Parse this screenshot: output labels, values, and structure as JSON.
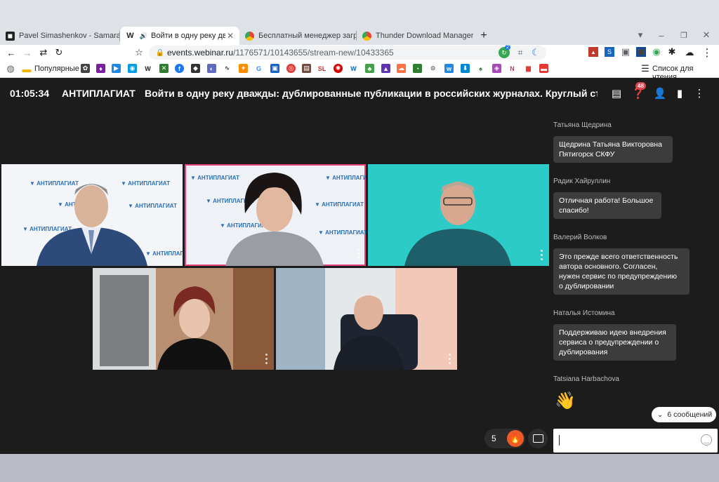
{
  "browser": {
    "tabs": [
      {
        "title": "Pavel Simashenkov - Samara, Ros",
        "favicon": "ms"
      },
      {
        "title": "Войти в одну реку дважды",
        "favicon": "W",
        "active": true
      },
      {
        "title": "Бесплатный менеджер загрузок",
        "favicon": "chrome"
      },
      {
        "title": "Thunder Download Manager - И",
        "favicon": "chrome"
      }
    ],
    "new_tab": "+",
    "window_controls": [
      "▾",
      "–",
      "❐",
      "✕"
    ],
    "url_host": "events.webinar.ru",
    "url_path": "/1176571/10143655/stream-new/10433365",
    "bookmarks_folder": "Популярные",
    "reading_list": "Список для чтения",
    "ext_badge": "2"
  },
  "webinar": {
    "timer": "01:05:34",
    "brand": "АНТИПЛАГИАТ",
    "title": "Войти в одну реку дважды: дублированные публикации в российских журналах. Круглый стол",
    "questions_badge": "48",
    "videos": [
      {
        "name": "participant-1",
        "logo": "АНТИПЛАГИАТ"
      },
      {
        "name": "participant-2",
        "logo": "АНТИПЛАГИАТ",
        "active_speaker": true
      },
      {
        "name": "participant-3"
      },
      {
        "name": "participant-4"
      },
      {
        "name": "participant-5"
      }
    ],
    "reactions_count": "5",
    "colors": {
      "accent": "#e8407a",
      "bg": "#1c1c1c",
      "fire": "#f05a24"
    }
  },
  "chat": {
    "messages": [
      {
        "author": "Татьяна Щедрина",
        "lines": [
          "Щедрина Татьяна Викторовна",
          "Пятигорск СКФУ"
        ]
      },
      {
        "author": "Радик Хайруллин",
        "lines": [
          "Отличная работа! Большое",
          "спасибо!"
        ]
      },
      {
        "author": "Валерий Волков",
        "lines": [
          "Это прежде всего ответственность",
          "автора основного.  Согласен,",
          "нужен сервис по предупреждению",
          "о дублировании"
        ]
      },
      {
        "author": "Наталья Истомина",
        "lines": [
          "Поддерживаю идею внедрения",
          "сервиса о предупреждении о",
          "дублирования"
        ]
      },
      {
        "author": "Tatsiana Harbachova",
        "lines": [
          "👋"
        ]
      }
    ],
    "new_messages": "6 сообщений",
    "input_value": ""
  }
}
